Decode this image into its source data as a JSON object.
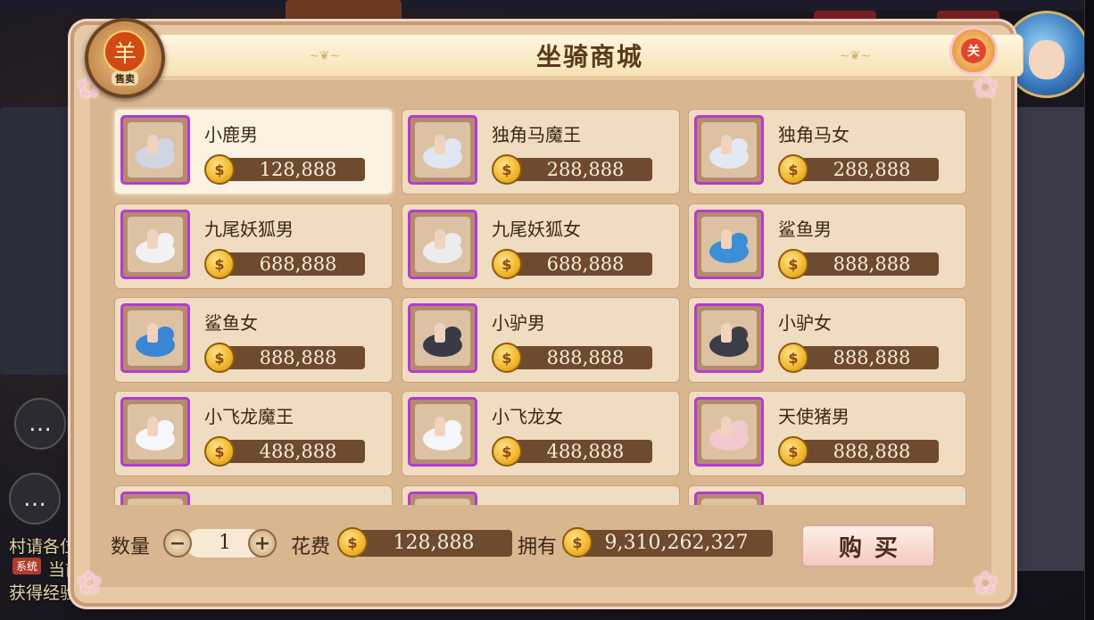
{
  "shop": {
    "title": "坐骑商城",
    "sell_label": "售卖",
    "sell_icon": "羊",
    "close_icon": "关"
  },
  "side": {
    "line1": "村请各位",
    "badge": "系统",
    "line2": "当前",
    "line3": "获得经验"
  },
  "items": [
    {
      "name": "小鹿男",
      "price": "128,888",
      "color": "#cfd6e2"
    },
    {
      "name": "独角马魔王",
      "price": "288,888",
      "color": "#dfe6f2"
    },
    {
      "name": "独角马女",
      "price": "288,888",
      "color": "#e3e8f3"
    },
    {
      "name": "九尾妖狐男",
      "price": "688,888",
      "color": "#f2f2f5"
    },
    {
      "name": "九尾妖狐女",
      "price": "688,888",
      "color": "#ecebee"
    },
    {
      "name": "鲨鱼男",
      "price": "888,888",
      "color": "#3c8fd6"
    },
    {
      "name": "鲨鱼女",
      "price": "888,888",
      "color": "#3a86d2"
    },
    {
      "name": "小驴男",
      "price": "888,888",
      "color": "#3a3a44"
    },
    {
      "name": "小驴女",
      "price": "888,888",
      "color": "#3d3d48"
    },
    {
      "name": "小飞龙魔王",
      "price": "488,888",
      "color": "#f6f8fb"
    },
    {
      "name": "小飞龙女",
      "price": "488,888",
      "color": "#f4f6fa"
    },
    {
      "name": "天使猪男",
      "price": "888,888",
      "color": "#f2c9cf"
    },
    {
      "name": "",
      "price": "",
      "color": "#e8e0ea"
    },
    {
      "name": "",
      "price": "",
      "color": "#e8e0ea"
    },
    {
      "name": "",
      "price": "",
      "color": "#e8e0ea"
    }
  ],
  "bottom": {
    "qty_label": "数量",
    "qty_value": "1",
    "minus": "−",
    "plus": "+",
    "cost_label": "花费",
    "cost_value": "128,888",
    "own_label": "拥有",
    "own_value": "9,310,262,327",
    "buy_label": "购买"
  },
  "coin_glyph": "$"
}
